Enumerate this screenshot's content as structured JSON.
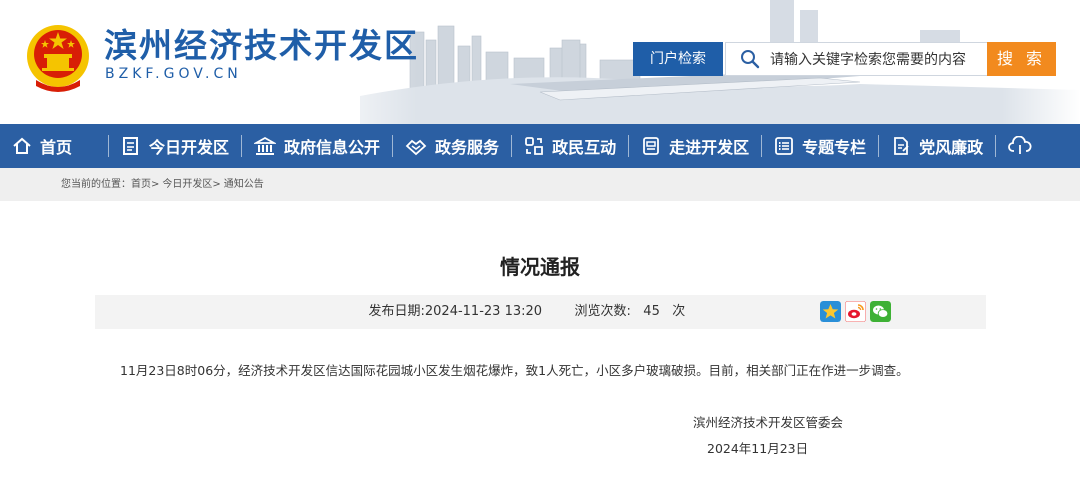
{
  "header": {
    "site_name": "滨州经济技术开发区",
    "site_domain": "BZKF.GOV.CN",
    "search_label": "门户检索",
    "search_placeholder": "请输入关键字检索您需要的内容",
    "search_button": "搜 索"
  },
  "nav": {
    "items": [
      {
        "label": "首页",
        "icon": "home-icon"
      },
      {
        "label": "今日开发区",
        "icon": "newspaper-icon"
      },
      {
        "label": "政府信息公开",
        "icon": "government-building-icon"
      },
      {
        "label": "政务服务",
        "icon": "service-icon"
      },
      {
        "label": "政民互动",
        "icon": "interaction-icon"
      },
      {
        "label": "走进开发区",
        "icon": "id-card-icon"
      },
      {
        "label": "专题专栏",
        "icon": "list-icon"
      },
      {
        "label": "党风廉政",
        "icon": "document-edit-icon"
      }
    ]
  },
  "breadcrumb": {
    "prefix": "您当前的位置：",
    "items": [
      "首页",
      "今日开发区",
      "通知公告"
    ],
    "separator": ">"
  },
  "article": {
    "title": "情况通报",
    "publish_label": "发布日期:",
    "publish_date": "2024-11-23 13:20",
    "views_label": "浏览次数:",
    "views_count": "45",
    "views_unit": "次",
    "body": "11月23日8时06分，经济技术开发区信达国际花园城小区发生烟花爆炸，致1人死亡，小区多户玻璃破损。目前，相关部门正在作进一步调查。",
    "signature_org": "滨州经济技术开发区管委会",
    "signature_date": "2024年11月23日"
  },
  "colors": {
    "brand_blue": "#1f5ea8",
    "nav_blue": "#2b5fa3",
    "search_orange": "#f28a1e"
  }
}
